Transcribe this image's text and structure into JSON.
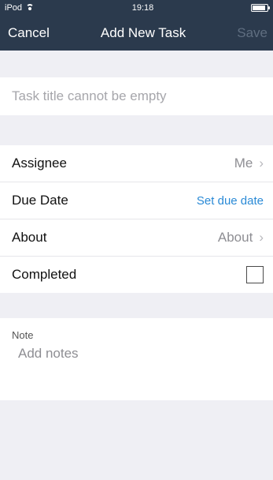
{
  "status_bar": {
    "device": "iPod",
    "time": "19:18",
    "wifi_icon": "wifi-icon",
    "battery_icon": "battery-icon"
  },
  "nav": {
    "cancel": "Cancel",
    "title": "Add New Task",
    "save": "Save"
  },
  "task_title": {
    "placeholder": "Task title cannot be empty"
  },
  "fields": [
    {
      "label": "Assignee",
      "value": "Me"
    },
    {
      "label": "Due Date",
      "value": "Set due date"
    },
    {
      "label": "About",
      "value": "About"
    },
    {
      "label": "Completed"
    }
  ],
  "note": {
    "label": "Note",
    "placeholder": "Add notes"
  },
  "colors": {
    "header": "#2b3a4d",
    "link": "#2a8ad6",
    "background": "#efeff4"
  }
}
